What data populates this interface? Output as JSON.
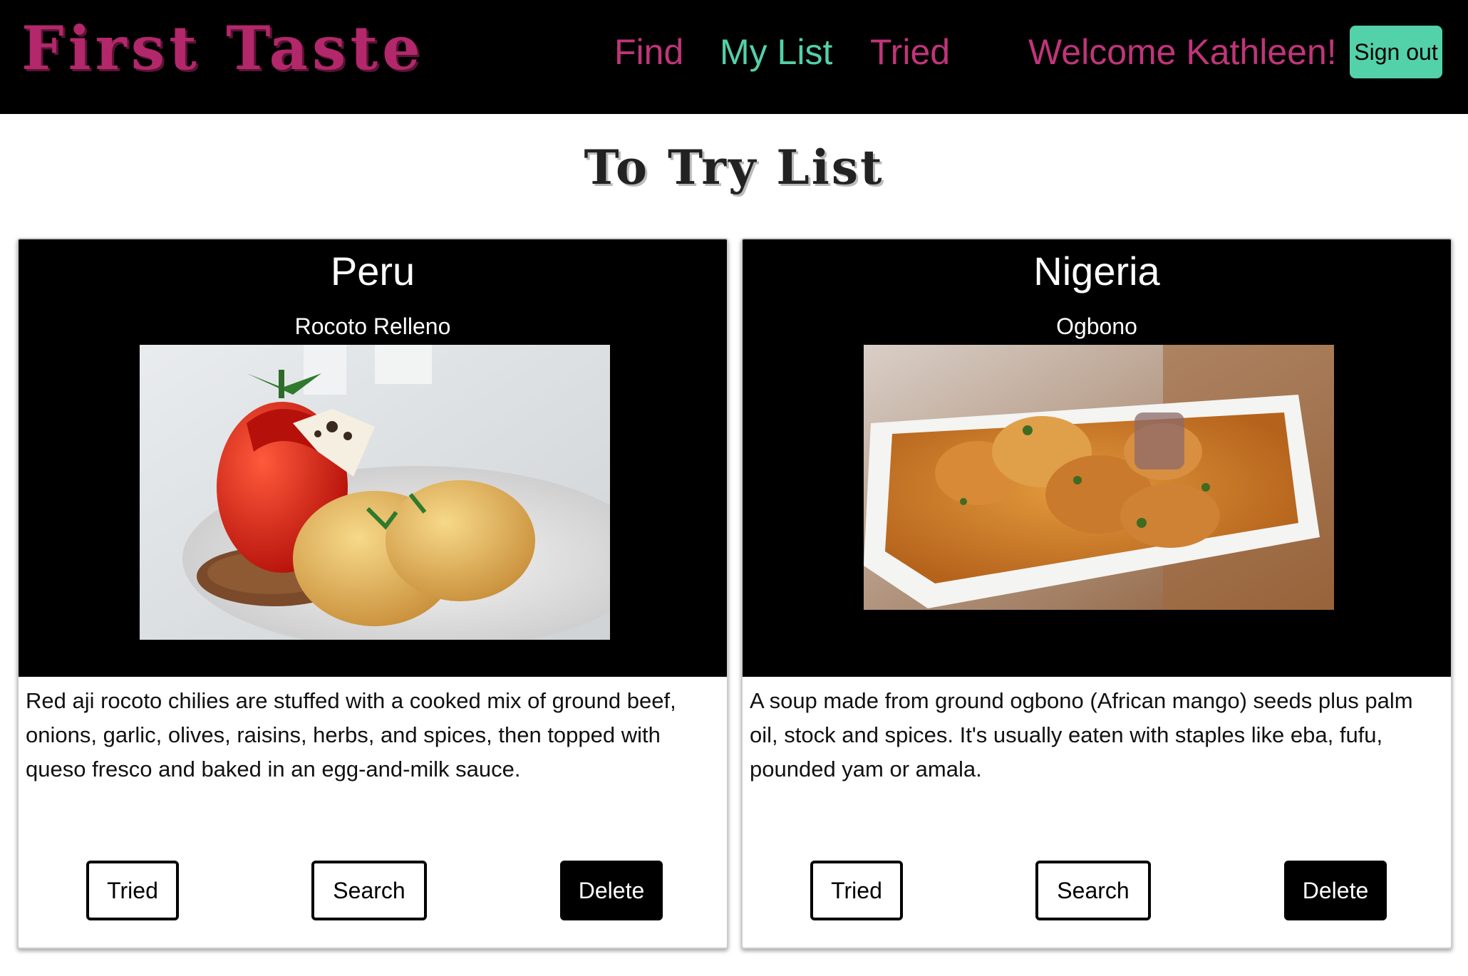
{
  "header": {
    "brand": "First Taste",
    "nav": {
      "find": "Find",
      "my_list": "My List",
      "tried": "Tried"
    },
    "welcome": "Welcome Kathleen!",
    "sign_out": "Sign out"
  },
  "page": {
    "title": "To Try List"
  },
  "cards": [
    {
      "country": "Peru",
      "dish": "Rocoto Relleno",
      "description": "Red aji rocoto chilies are stuffed with a cooked mix of ground beef, onions, garlic, olives, raisins, herbs, and spices, then topped with queso fresco and baked in an egg-and-milk sauce.",
      "buttons": {
        "tried": "Tried",
        "search": "Search",
        "delete": "Delete"
      }
    },
    {
      "country": "Nigeria",
      "dish": "Ogbono",
      "description": "A soup made from ground ogbono (African mango) seeds plus palm oil, stock and spices. It's usually eaten with staples like eba, fufu, pounded yam or amala.",
      "buttons": {
        "tried": "Tried",
        "search": "Search",
        "delete": "Delete"
      }
    }
  ],
  "colors": {
    "brand_pink": "#c0357a",
    "accent_teal": "#53d1a9",
    "header_bg": "#000000"
  }
}
